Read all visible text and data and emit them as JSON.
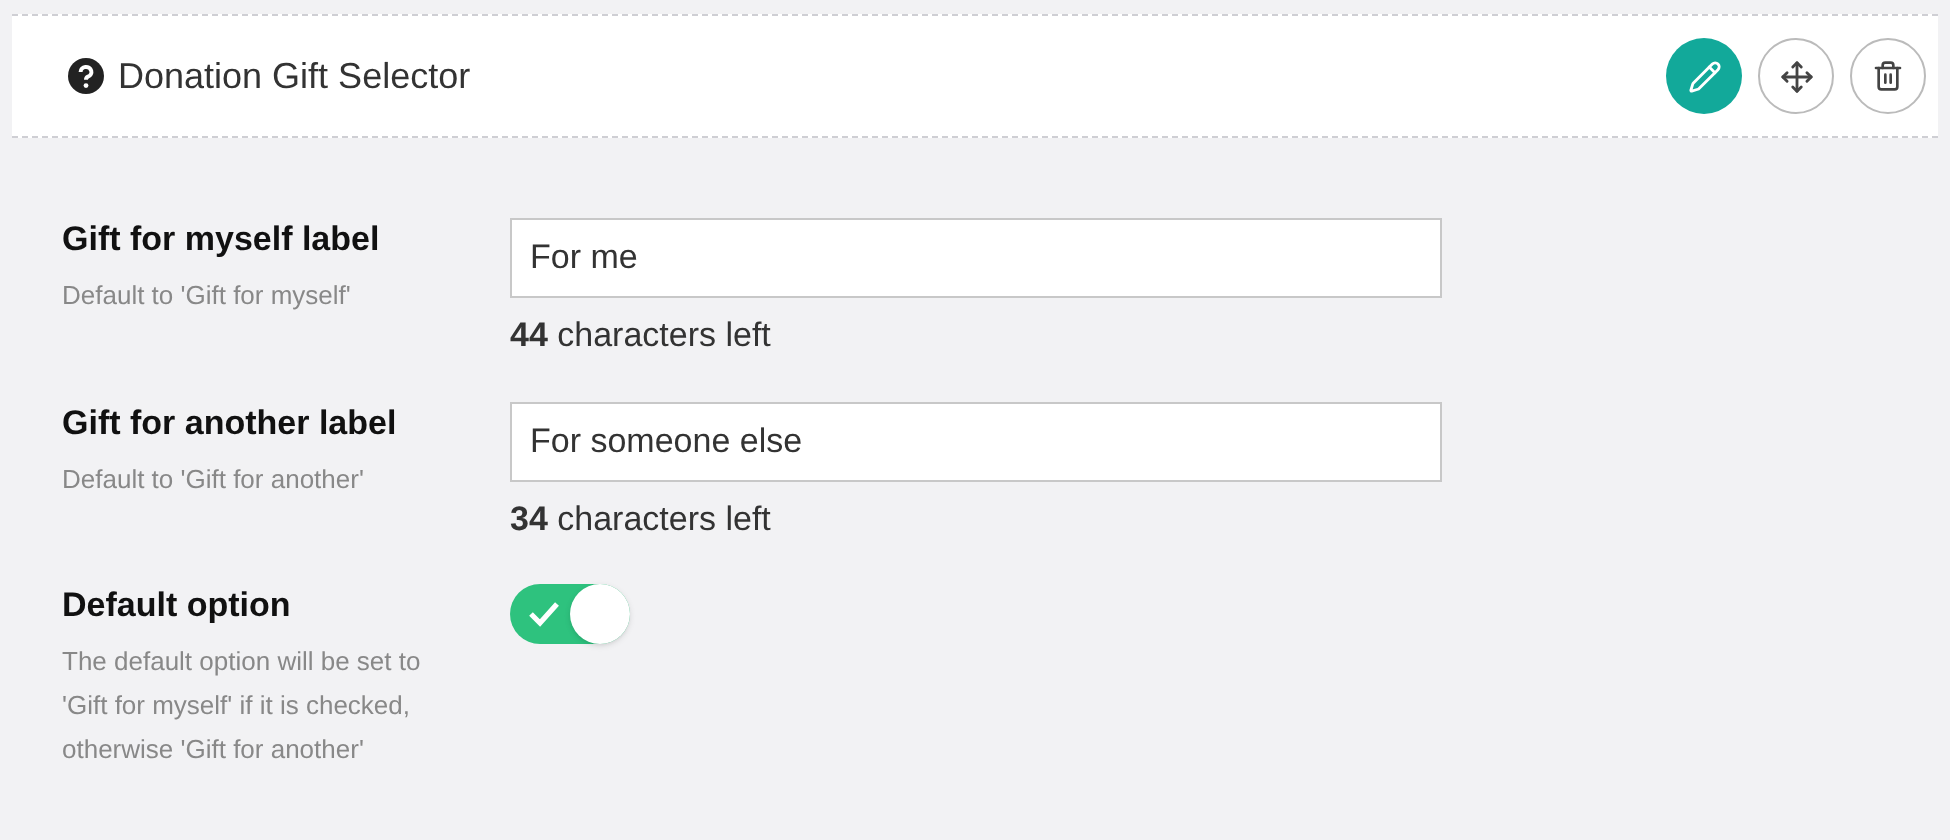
{
  "header": {
    "title": "Donation Gift Selector"
  },
  "fields": [
    {
      "kind": "text",
      "label": "Gift for myself label",
      "help": "Default to 'Gift for myself'",
      "value": "For me",
      "counter": "**44** characters left"
    },
    {
      "kind": "text",
      "label": "Gift for another label",
      "help": "Default to 'Gift for another'",
      "value": "For someone else",
      "counter": "**34** characters left"
    },
    {
      "kind": "toggle",
      "label": "Default option",
      "help": "The default option will be set to 'Gift for myself' if it is checked, otherwise 'Gift for another'",
      "on": true
    }
  ]
}
